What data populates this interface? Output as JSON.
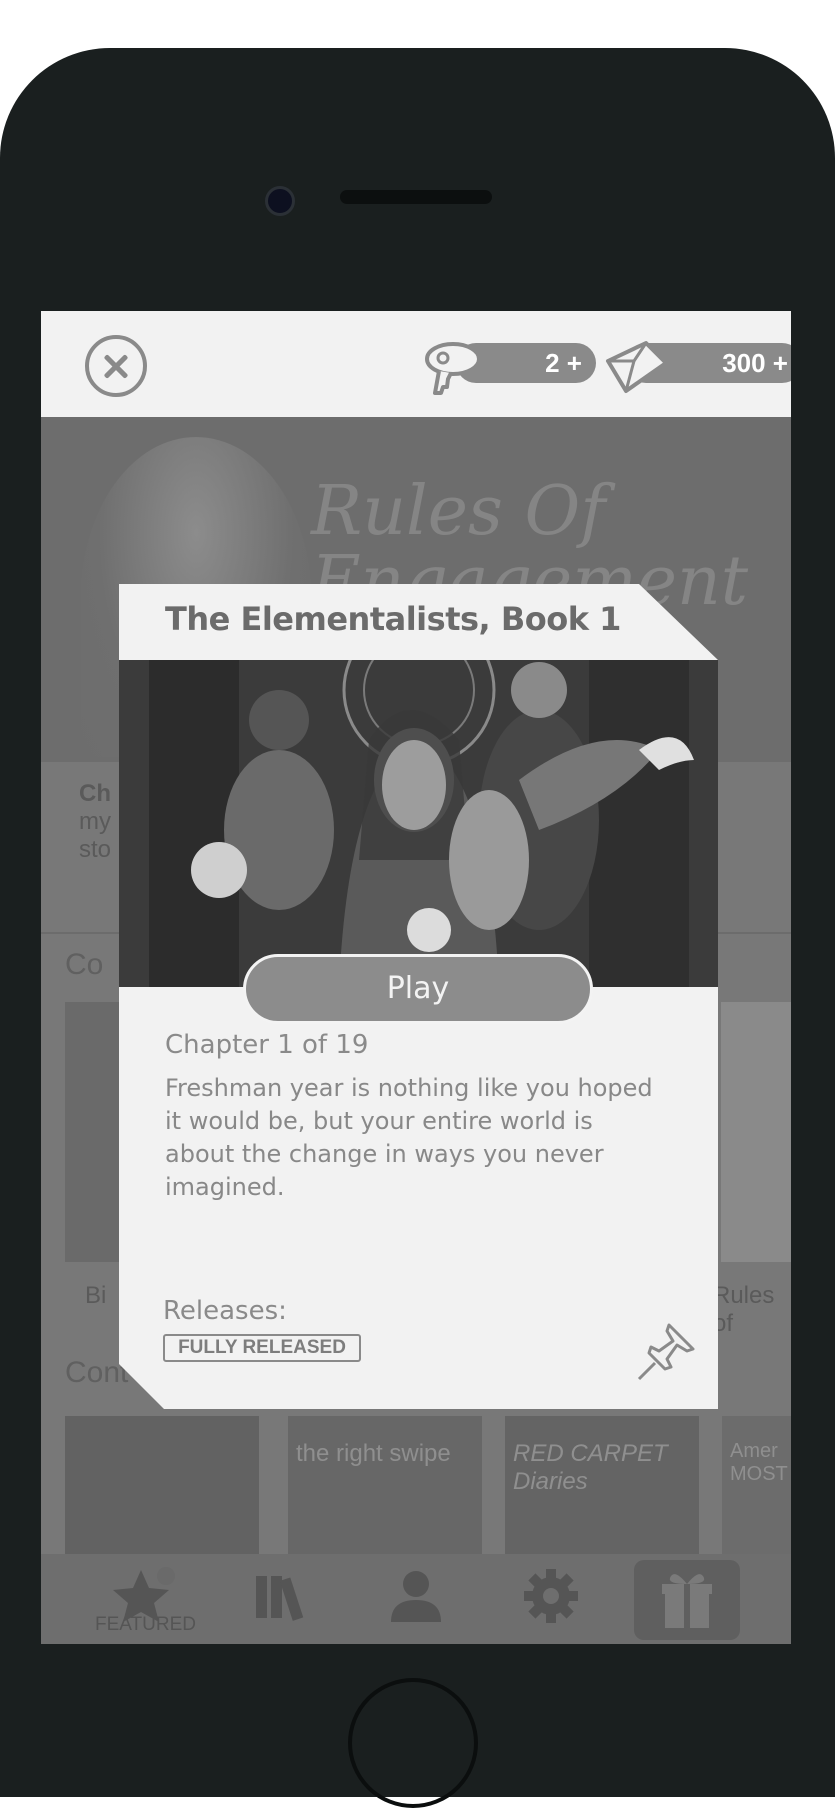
{
  "topbar": {
    "close_icon": "close-icon",
    "keys": {
      "icon": "key-icon",
      "label": "2 +"
    },
    "gems": {
      "icon": "gem-icon",
      "label": "300 +"
    }
  },
  "background": {
    "hero_title": "Rules Of Engagement",
    "promo_lines": [
      "Ch",
      "my",
      "sto"
    ],
    "section_heads": [
      "Co",
      "Cont"
    ],
    "row1_captions": [
      "Bi",
      "Rules of"
    ],
    "row2_titles": [
      "the right swipe",
      "RED CARPET Diaries",
      "Amer MOST"
    ],
    "nav": {
      "featured_label": "FEATURED"
    }
  },
  "modal": {
    "title": "The Elementalists, Book 1",
    "play_label": "Play",
    "chapter": "Chapter 1 of 19",
    "description": "Freshman year is nothing like you hoped it would be, but your entire world is about the change in ways you never imagined.",
    "releases_label": "Releases:",
    "release_status": "FULLY RELEASED"
  }
}
